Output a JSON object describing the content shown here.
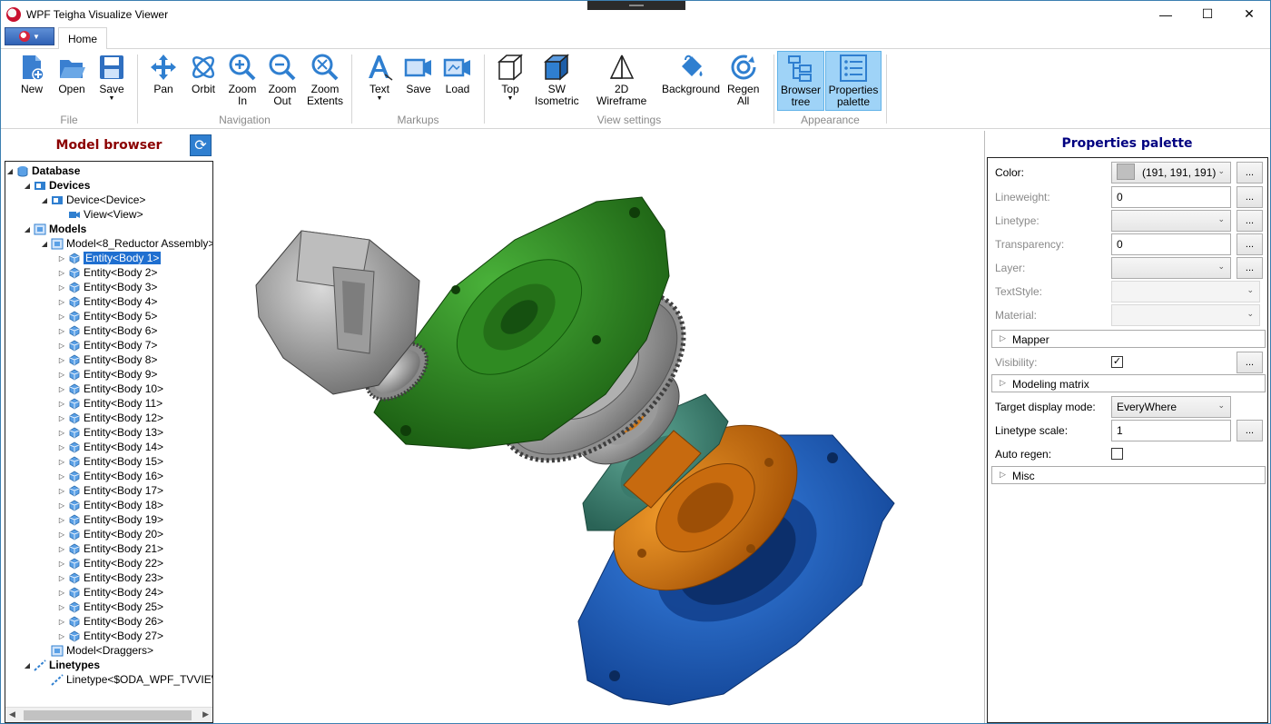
{
  "window": {
    "title": "WPF Teigha Visualize Viewer",
    "controls": {
      "minimize": "—",
      "maximize": "☐",
      "close": "✕"
    }
  },
  "tabs": {
    "home": "Home"
  },
  "ribbon": {
    "file": {
      "label": "File",
      "new": "New",
      "open": "Open",
      "save": "Save"
    },
    "navigation": {
      "label": "Navigation",
      "pan": "Pan",
      "orbit": "Orbit",
      "zoom_in_1": "Zoom",
      "zoom_in_2": "In",
      "zoom_out_1": "Zoom",
      "zoom_out_2": "Out",
      "zoom_ext_1": "Zoom",
      "zoom_ext_2": "Extents"
    },
    "markups": {
      "label": "Markups",
      "text": "Text",
      "save": "Save",
      "load": "Load"
    },
    "view_settings": {
      "label": "View settings",
      "top": "Top",
      "sw_1": "SW",
      "sw_2": "Isometric",
      "wire_1": "2D",
      "wire_2": "Wireframe",
      "background": "Background",
      "regen_1": "Regen",
      "regen_2": "All"
    },
    "appearance": {
      "label": "Appearance",
      "browser_1": "Browser",
      "browser_2": "tree",
      "props_1": "Properties",
      "props_2": "palette"
    }
  },
  "model_browser": {
    "title": "Model browser",
    "tree": [
      {
        "label": "Database",
        "depth": 0,
        "exp": "◢",
        "icon": "database",
        "bold": true
      },
      {
        "label": "Devices",
        "depth": 1,
        "exp": "◢",
        "icon": "device",
        "bold": true
      },
      {
        "label": "Device<Device>",
        "depth": 2,
        "exp": "◢",
        "icon": "device"
      },
      {
        "label": "View<View>",
        "depth": 3,
        "exp": "",
        "icon": "camera"
      },
      {
        "label": "Models",
        "depth": 1,
        "exp": "◢",
        "icon": "model",
        "bold": true
      },
      {
        "label": "Model<8_Reductor Assembly>",
        "depth": 2,
        "exp": "◢",
        "icon": "model"
      },
      {
        "label": "Entity<Body 1>",
        "depth": 3,
        "exp": "▷",
        "icon": "entity",
        "selected": true
      },
      {
        "label": "Entity<Body 2>",
        "depth": 3,
        "exp": "▷",
        "icon": "entity"
      },
      {
        "label": "Entity<Body 3>",
        "depth": 3,
        "exp": "▷",
        "icon": "entity"
      },
      {
        "label": "Entity<Body 4>",
        "depth": 3,
        "exp": "▷",
        "icon": "entity"
      },
      {
        "label": "Entity<Body 5>",
        "depth": 3,
        "exp": "▷",
        "icon": "entity"
      },
      {
        "label": "Entity<Body 6>",
        "depth": 3,
        "exp": "▷",
        "icon": "entity"
      },
      {
        "label": "Entity<Body 7>",
        "depth": 3,
        "exp": "▷",
        "icon": "entity"
      },
      {
        "label": "Entity<Body 8>",
        "depth": 3,
        "exp": "▷",
        "icon": "entity"
      },
      {
        "label": "Entity<Body 9>",
        "depth": 3,
        "exp": "▷",
        "icon": "entity"
      },
      {
        "label": "Entity<Body 10>",
        "depth": 3,
        "exp": "▷",
        "icon": "entity"
      },
      {
        "label": "Entity<Body 11>",
        "depth": 3,
        "exp": "▷",
        "icon": "entity"
      },
      {
        "label": "Entity<Body 12>",
        "depth": 3,
        "exp": "▷",
        "icon": "entity"
      },
      {
        "label": "Entity<Body 13>",
        "depth": 3,
        "exp": "▷",
        "icon": "entity"
      },
      {
        "label": "Entity<Body 14>",
        "depth": 3,
        "exp": "▷",
        "icon": "entity"
      },
      {
        "label": "Entity<Body 15>",
        "depth": 3,
        "exp": "▷",
        "icon": "entity"
      },
      {
        "label": "Entity<Body 16>",
        "depth": 3,
        "exp": "▷",
        "icon": "entity"
      },
      {
        "label": "Entity<Body 17>",
        "depth": 3,
        "exp": "▷",
        "icon": "entity"
      },
      {
        "label": "Entity<Body 18>",
        "depth": 3,
        "exp": "▷",
        "icon": "entity"
      },
      {
        "label": "Entity<Body 19>",
        "depth": 3,
        "exp": "▷",
        "icon": "entity"
      },
      {
        "label": "Entity<Body 20>",
        "depth": 3,
        "exp": "▷",
        "icon": "entity"
      },
      {
        "label": "Entity<Body 21>",
        "depth": 3,
        "exp": "▷",
        "icon": "entity"
      },
      {
        "label": "Entity<Body 22>",
        "depth": 3,
        "exp": "▷",
        "icon": "entity"
      },
      {
        "label": "Entity<Body 23>",
        "depth": 3,
        "exp": "▷",
        "icon": "entity"
      },
      {
        "label": "Entity<Body 24>",
        "depth": 3,
        "exp": "▷",
        "icon": "entity"
      },
      {
        "label": "Entity<Body 25>",
        "depth": 3,
        "exp": "▷",
        "icon": "entity"
      },
      {
        "label": "Entity<Body 26>",
        "depth": 3,
        "exp": "▷",
        "icon": "entity"
      },
      {
        "label": "Entity<Body 27>",
        "depth": 3,
        "exp": "▷",
        "icon": "entity"
      },
      {
        "label": "Model<Draggers>",
        "depth": 2,
        "exp": "",
        "icon": "model"
      },
      {
        "label": "Linetypes",
        "depth": 1,
        "exp": "◢",
        "icon": "linetype",
        "bold": true
      },
      {
        "label": "Linetype<$ODA_WPF_TVVIEWER>",
        "depth": 2,
        "exp": "",
        "icon": "linetype"
      }
    ]
  },
  "properties": {
    "title": "Properties palette",
    "color_label": "Color:",
    "color_value": "(191, 191, 191)",
    "lineweight_label": "Lineweight:",
    "lineweight_value": "0",
    "linetype_label": "Linetype:",
    "transparency_label": "Transparency:",
    "transparency_value": "0",
    "layer_label": "Layer:",
    "textstyle_label": "TextStyle:",
    "material_label": "Material:",
    "mapper": "Mapper",
    "visibility_label": "Visibility:",
    "visibility_checked": true,
    "modeling_matrix": "Modeling matrix",
    "target_label": "Target display mode:",
    "target_value": "EveryWhere",
    "ltscale_label": "Linetype scale:",
    "ltscale_value": "1",
    "autoregen_label": "Auto regen:",
    "autoregen_checked": false,
    "misc": "Misc",
    "dots": "..."
  },
  "colors": {
    "accent": "#2f7fd0",
    "green_part": "#2e8b1e",
    "orange_part": "#d97a12",
    "blue_part": "#1f63c8",
    "gray_part": "#b5b5b5",
    "teal_part": "#3f8b7a"
  }
}
